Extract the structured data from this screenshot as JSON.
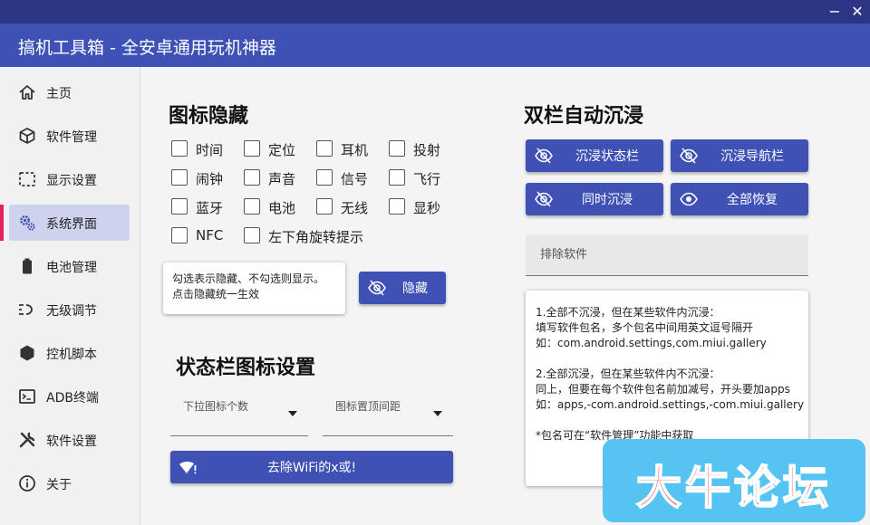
{
  "window": {
    "title": "搞机工具箱 - 全安卓通用玩机神器",
    "minimize_symbol": "−",
    "close_symbol": "✕"
  },
  "sidebar": {
    "items": [
      {
        "label": "主页",
        "icon": "home-icon"
      },
      {
        "label": "软件管理",
        "icon": "box-icon"
      },
      {
        "label": "显示设置",
        "icon": "display-frame-icon"
      },
      {
        "label": "系统界面",
        "icon": "gears-icon",
        "active": true
      },
      {
        "label": "电池管理",
        "icon": "battery-icon"
      },
      {
        "label": "无级调节",
        "icon": "adjust-icon"
      },
      {
        "label": "控机脚本",
        "icon": "hexagon-icon"
      },
      {
        "label": "ADB终端",
        "icon": "terminal-icon"
      },
      {
        "label": "软件设置",
        "icon": "tools-icon"
      },
      {
        "label": "关于",
        "icon": "info-icon"
      }
    ]
  },
  "icon_hide": {
    "title": "图标隐藏",
    "checkboxes": [
      "时间",
      "定位",
      "耳机",
      "投射",
      "闹钟",
      "声音",
      "信号",
      "飞行",
      "蓝牙",
      "电池",
      "无线",
      "显秒",
      "NFC",
      "左下角旋转提示"
    ],
    "tip_line1": "勾选表示隐藏、不勾选则显示。",
    "tip_line2": "点击隐藏统一生效",
    "hide_button": "隐藏"
  },
  "statusbar_icons": {
    "title": "状态栏图标设置",
    "dropdown_count_hint": "下拉图标个数",
    "dropdown_margin_hint": "图标置顶间距",
    "remove_wifi_button": "去除WiFi的x或!"
  },
  "immersive": {
    "title": "双栏自动沉浸",
    "buttons": {
      "status": "沉浸状态栏",
      "nav": "沉浸导航栏",
      "both": "同时沉浸",
      "restore": "全部恢复"
    },
    "exclude_placeholder": "排除软件",
    "info_lines": [
      "1.全部不沉浸，但在某些软件内沉浸：",
      "填写软件包名，多个包名中间用英文逗号隔开",
      "如：com.android.settings,com.miui.gallery",
      "",
      "2.全部沉浸，但在某些软件内不沉浸：",
      "同上，但要在每个软件包名前加减号，开头要加apps",
      "如：apps,-com.android.settings,-com.miui.gallery",
      "",
      "*包名可在“软件管理”功能中获取"
    ]
  },
  "watermark": {
    "text": "大牛论坛"
  },
  "colors": {
    "titlebar": "#3f51b5",
    "topbar": "#2d3584",
    "accent": "#3f51b5",
    "active_nav_bg": "#cfd2ec",
    "active_indicator": "#e0245e",
    "watermark_bg": "#56c4f2",
    "watermark_text": "#e8102a"
  }
}
